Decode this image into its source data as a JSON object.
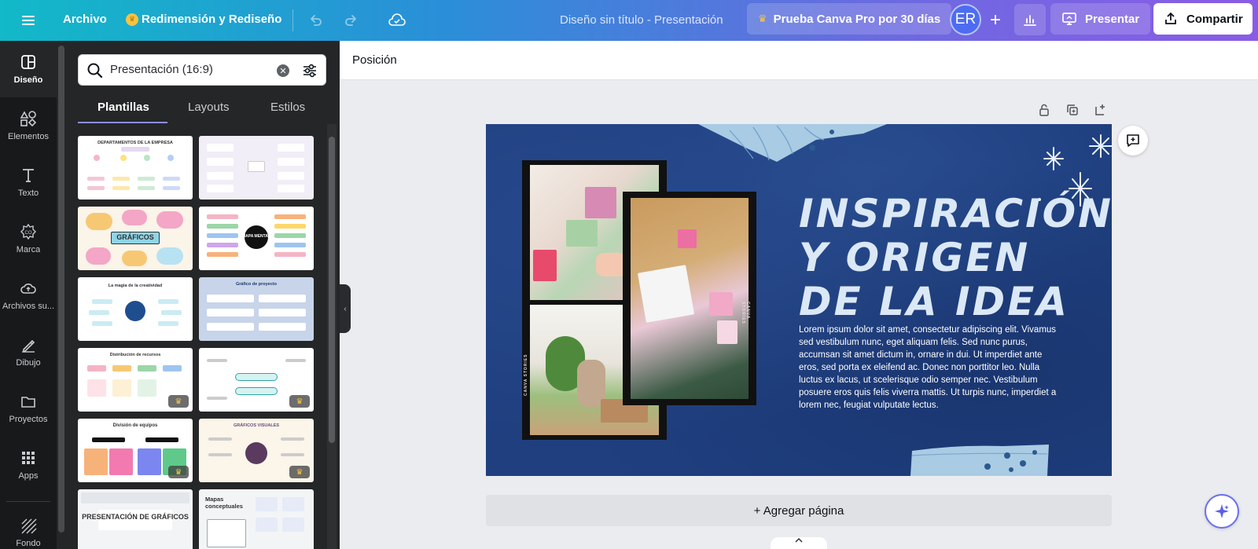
{
  "topbar": {
    "file_label": "Archivo",
    "resize_label": "Redimensión y Rediseño",
    "doc_title": "Diseño sin título - Presentación",
    "pro_trial_label": "Prueba Canva Pro por 30 días",
    "avatar_initials": "ER",
    "present_label": "Presentar",
    "share_label": "Compartir"
  },
  "rail": {
    "items": [
      {
        "label": "Diseño",
        "icon": "design-icon"
      },
      {
        "label": "Elementos",
        "icon": "elements-icon"
      },
      {
        "label": "Texto",
        "icon": "text-icon"
      },
      {
        "label": "Marca",
        "icon": "brand-icon"
      },
      {
        "label": "Archivos su...",
        "icon": "uploads-icon"
      },
      {
        "label": "Dibujo",
        "icon": "draw-icon"
      },
      {
        "label": "Proyectos",
        "icon": "projects-icon"
      },
      {
        "label": "Apps",
        "icon": "apps-icon"
      },
      {
        "label": "Fondo",
        "icon": "background-icon"
      }
    ]
  },
  "panel": {
    "search_value": "Presentación (16:9)",
    "tabs": [
      "Plantillas",
      "Layouts",
      "Estilos"
    ],
    "templates": [
      {
        "title": "DEPARTAMENTOS DE LA EMPRESA",
        "pro": false
      },
      {
        "title": "",
        "pro": false
      },
      {
        "title": "GRÁFICOS",
        "pro": false
      },
      {
        "title": "MAPA MENTAL",
        "pro": false
      },
      {
        "title": "La magia de la creatividad",
        "pro": false
      },
      {
        "title": "Gráfico de proyecto",
        "pro": false
      },
      {
        "title": "Distribución de recursos",
        "pro": true
      },
      {
        "title": "",
        "pro": true
      },
      {
        "title": "División de equipos",
        "pro": true
      },
      {
        "title": "GRÁFICOS VISUALES",
        "pro": true
      },
      {
        "title": "PRESENTACIÓN DE GRÁFICOS",
        "pro": false
      },
      {
        "title": "Mapas conceptuales",
        "pro": false
      }
    ]
  },
  "canvas": {
    "position_label": "Posición",
    "slide_title": "Inspiración y origen de la idea",
    "slide_body": "Lorem ipsum dolor sit amet, consectetur adipiscing elit. Vivamus sed vestibulum nunc, eget aliquam felis. Sed nunc purus, accumsan sit amet dictum in, ornare in dui. Ut imperdiet ante eros, sed porta ex eleifend ac. Donec non porttitor leo. Nulla luctus ex lacus, ut scelerisque odio semper nec. Vestibulum posuere eros quis felis viverra mattis. Ut turpis nunc, imperdiet a lorem nec, feugiat vulputate lectus.",
    "film_label": "CANVA STORIES",
    "add_page_label": "+ Agregar página"
  },
  "colors": {
    "slide_bg": "#1f3f7f",
    "title_color": "#dbe8f6",
    "accent": "#8b8dff"
  }
}
